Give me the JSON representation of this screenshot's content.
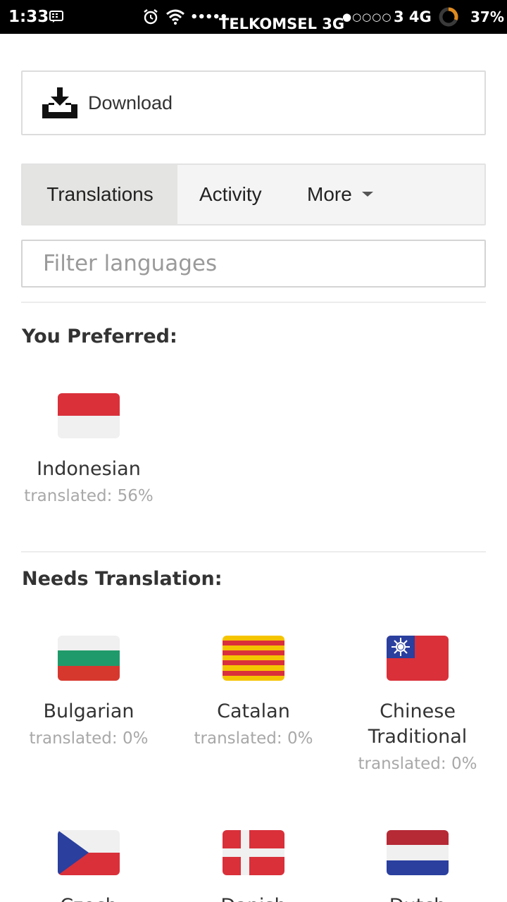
{
  "status_bar": {
    "time": "1:33",
    "carrier_1": "TELKOMSEL 3G",
    "carrier_2": "3 4G",
    "battery": "37%",
    "icons": [
      "bbm-icon",
      "alarm-icon",
      "wifi-icon",
      "signal-dots-icon",
      "battery-ring-icon"
    ]
  },
  "download": {
    "label": "Download",
    "icon": "download-tray-icon"
  },
  "tabs": [
    {
      "label": "Translations",
      "active": true
    },
    {
      "label": "Activity",
      "active": false
    },
    {
      "label": "More",
      "active": false,
      "has_dropdown": true
    }
  ],
  "filter": {
    "placeholder": "Filter languages",
    "value": ""
  },
  "preferred": {
    "title": "You Preferred:",
    "languages": [
      {
        "name": "Indonesian",
        "status_label": "translated:",
        "percent": "56%",
        "flag": "indonesia-flag"
      }
    ]
  },
  "needs_translation": {
    "title": "Needs Translation:",
    "languages": [
      {
        "name": "Bulgarian",
        "status_label": "translated:",
        "percent": "0%",
        "flag": "bulgaria-flag"
      },
      {
        "name": "Catalan",
        "status_label": "translated:",
        "percent": "0%",
        "flag": "catalonia-flag"
      },
      {
        "name": "Chinese Traditional",
        "status_label": "translated:",
        "percent": "0%",
        "flag": "taiwan-flag"
      },
      {
        "name": "Czech",
        "flag": "czech-flag"
      },
      {
        "name": "Danish",
        "flag": "denmark-flag"
      },
      {
        "name": "Dutch",
        "flag": "netherlands-flag"
      }
    ]
  },
  "colors": {
    "accent_download": "#111111",
    "active_tab_bg": "#e4e4e2",
    "tab_bar_bg": "#f4f4f4",
    "muted_text": "#a8a8a8",
    "flag_red": "#d9303a"
  }
}
